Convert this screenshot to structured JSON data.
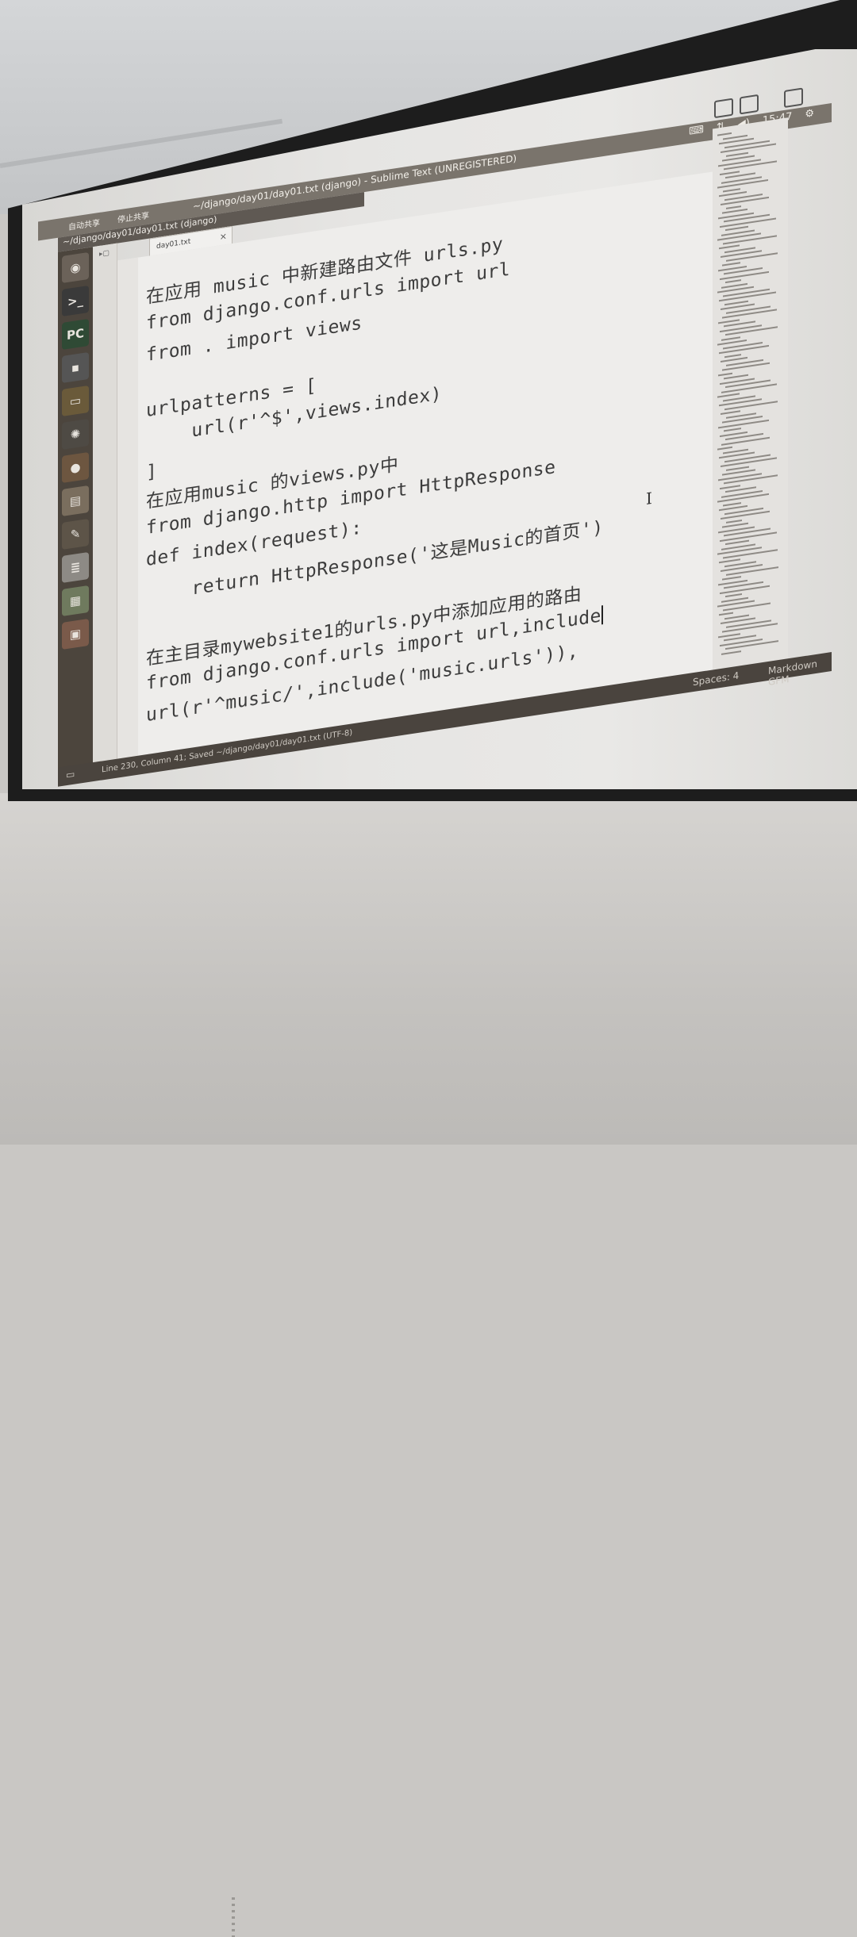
{
  "top_bar": {
    "share_start": "自动共享",
    "share_stop": "停止共享",
    "window_title": "~/django/day01/day01.txt (django) - Sublime Text (UNREGISTERED)",
    "time": "15:47"
  },
  "path_bar": "~/django/day01/day01.txt (django)",
  "tab": {
    "label": "day01.txt",
    "close": "×"
  },
  "code": [
    "在应用 music 中新建路由文件 urls.py",
    "from django.conf.urls import url",
    "from . import views",
    "",
    "urlpatterns = [",
    "    url(r'^$',views.index)",
    "",
    "]",
    "在应用music 的views.py中",
    "from django.http import HttpResponse",
    "def index(request):",
    "    return HttpResponse('这是Music的首页')",
    "",
    "在主目录mywebsite1的urls.py中添加应用的路由",
    "from django.conf.urls import url,include",
    "url(r'^music/',include('music.urls')),"
  ],
  "status_bar": {
    "position": "Line 230, Column 41; Saved ~/django/day01/day01.txt (UTF-8)",
    "spaces": "Spaces: 4",
    "syntax": "Markdown GFM"
  },
  "launcher": [
    {
      "name": "ubuntu-dash-icon",
      "glyph": "◉"
    },
    {
      "name": "terminal-icon",
      "glyph": ">_"
    },
    {
      "name": "pycharm-icon",
      "glyph": "PC"
    },
    {
      "name": "app-icon",
      "glyph": "▪"
    },
    {
      "name": "files-icon",
      "glyph": "▭"
    },
    {
      "name": "network-icon",
      "glyph": "✺"
    },
    {
      "name": "browser-icon",
      "glyph": "●"
    },
    {
      "name": "archive-icon",
      "glyph": "▤"
    },
    {
      "name": "microphone-icon",
      "glyph": "✎"
    },
    {
      "name": "document-icon",
      "glyph": "≣"
    },
    {
      "name": "spreadsheet-icon",
      "glyph": "▦"
    },
    {
      "name": "image-viewer-icon",
      "glyph": "▣"
    }
  ]
}
